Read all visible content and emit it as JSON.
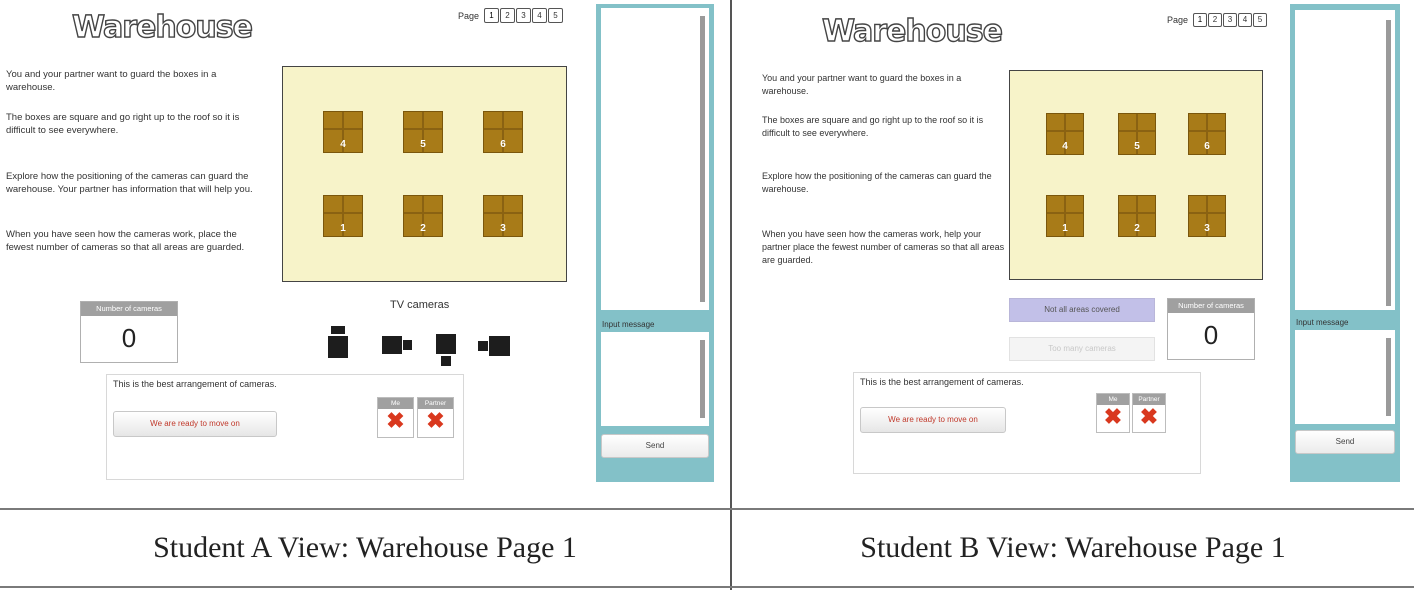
{
  "student_a": {
    "title": "Warehouse",
    "pager_label": "Page",
    "pages": [
      "1",
      "2",
      "3",
      "4",
      "5"
    ],
    "intro": [
      "You and your partner want to guard the boxes in a warehouse.",
      "The boxes are square and go right up to the roof so it is difficult to see everywhere.",
      "Explore how the positioning of the cameras can guard the warehouse. Your partner has information that will help you.",
      "When you have seen how the cameras work, place the fewest number of cameras so that all areas are guarded."
    ],
    "boxes": [
      "4",
      "5",
      "6",
      "1",
      "2",
      "3"
    ],
    "counter_label": "Number of cameras",
    "counter_value": "0",
    "tv_label": "TV cameras",
    "best_text": "This is the best arrangement of cameras.",
    "ready_button": "We are ready to move on",
    "vote_me": "Me",
    "vote_partner": "Partner",
    "vote_mark": "✖",
    "chat_input_label": "Input message",
    "send_button": "Send"
  },
  "student_b": {
    "title": "Warehouse",
    "pager_label": "Page",
    "pages": [
      "1",
      "2",
      "3",
      "4",
      "5"
    ],
    "intro": [
      "You and your partner want to guard the boxes in a warehouse.",
      "The boxes are square and go right up to the roof so it is difficult to see everywhere.",
      "Explore how the positioning of the cameras can guard the warehouse.",
      "When you have seen how the cameras work, help your partner place the fewest number of cameras so that all areas are guarded."
    ],
    "boxes": [
      "4",
      "5",
      "6",
      "1",
      "2",
      "3"
    ],
    "status_button": "Not all areas covered",
    "fewer_button": "Too many cameras",
    "counter_label": "Number of cameras",
    "counter_value": "0",
    "best_text": "This is the best arrangement of cameras.",
    "ready_button": "We are ready to move on",
    "vote_me": "Me",
    "vote_partner": "Partner",
    "vote_mark": "✖",
    "chat_input_label": "Input message",
    "send_button": "Send"
  },
  "captions": {
    "left": "Student A View: Warehouse Page 1",
    "right": "Student B View: Warehouse Page 1"
  },
  "colors": {
    "board": "#f7f3c9",
    "box": "#a87b18",
    "chat_frame": "#83c1c8",
    "status_button": "#c2c0e8",
    "vote_cross": "#d9381e"
  }
}
